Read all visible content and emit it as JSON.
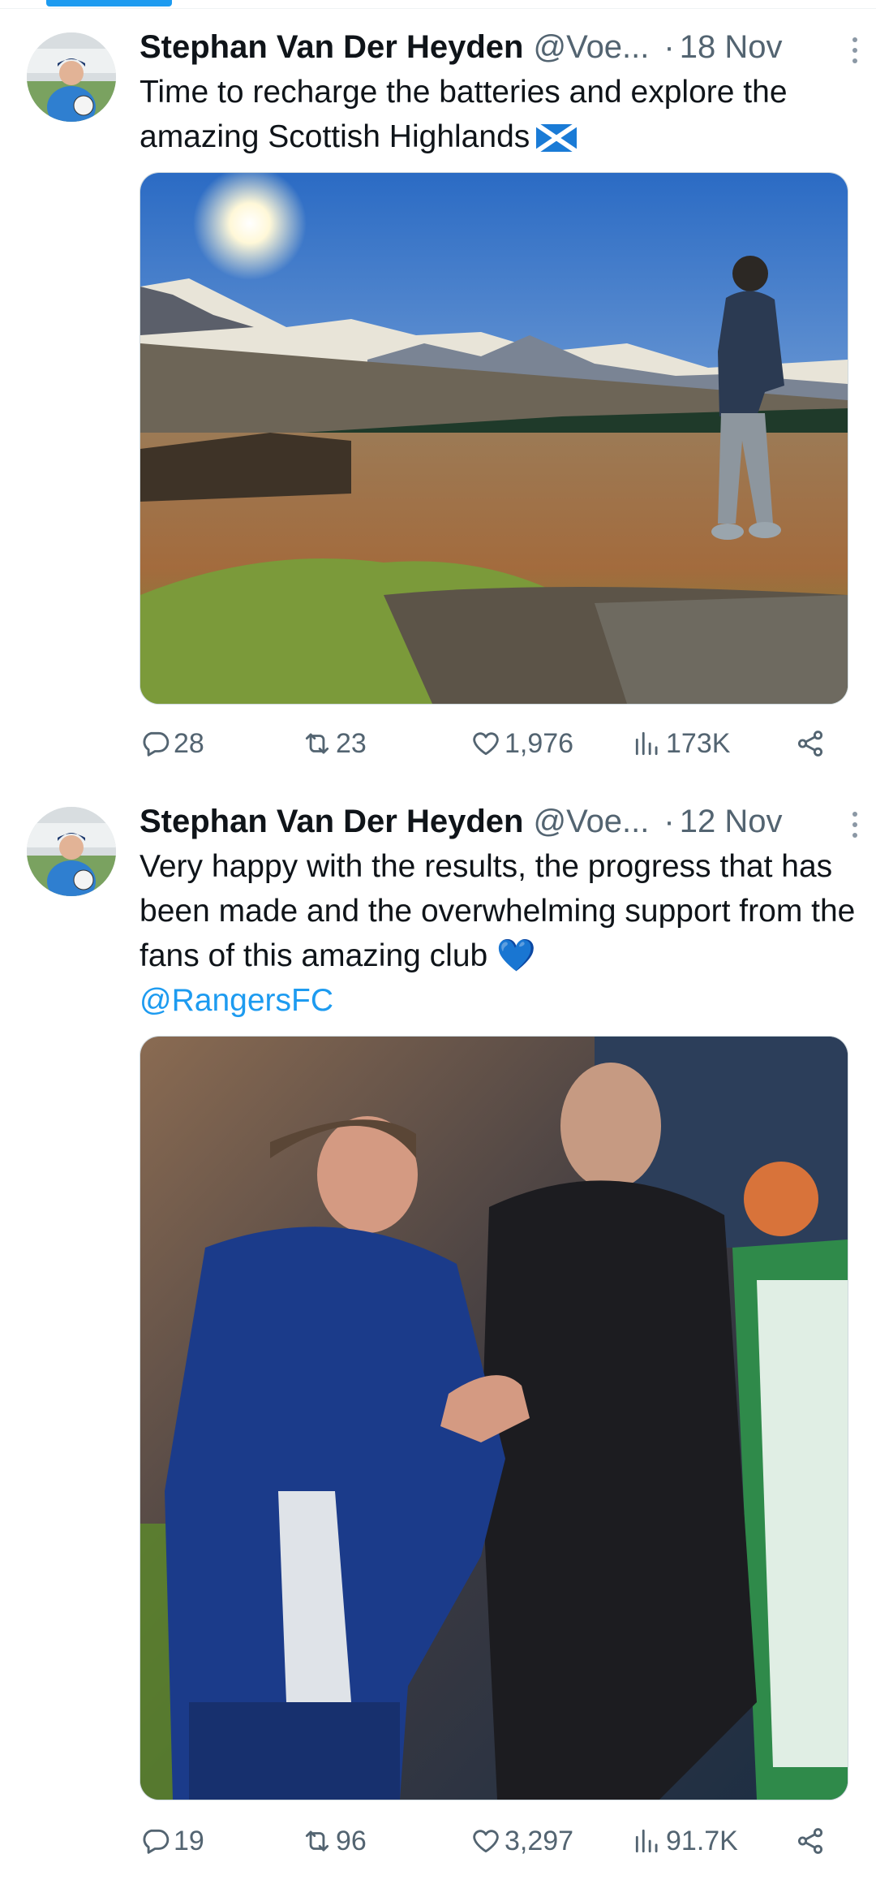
{
  "tweets": [
    {
      "author": "Stephan Van Der Heyden",
      "handle": "@Voe...",
      "separator": "·",
      "time": "18 Nov",
      "text": "Time to recharge the batteries and explore the amazing Scottish Highlands",
      "text_emoji": "scotland-flag",
      "mention": "",
      "media": "photo-man-overlooking-highlands-loch",
      "counts": {
        "replies": "28",
        "reposts": "23",
        "likes": "1,976",
        "views": "173K"
      }
    },
    {
      "author": "Stephan Van Der Heyden",
      "handle": "@Voe...",
      "separator": "·",
      "time": "12 Nov",
      "text": "Very happy with the results, the progress that has been made and the overwhelming support from the fans of this amazing club 💙",
      "mention": "@RangersFC",
      "media": "photo-coaches-greeting-pitchside",
      "counts": {
        "replies": "19",
        "reposts": "96",
        "likes": "3,297",
        "views": "91.7K"
      }
    }
  ],
  "colors": {
    "accent": "#1d9bf0",
    "text": "#0f1419",
    "muted": "#536471",
    "divider": "#eff3f4"
  },
  "icons": [
    "reply-icon",
    "repost-icon",
    "like-icon",
    "views-icon",
    "share-icon",
    "more-icon"
  ]
}
